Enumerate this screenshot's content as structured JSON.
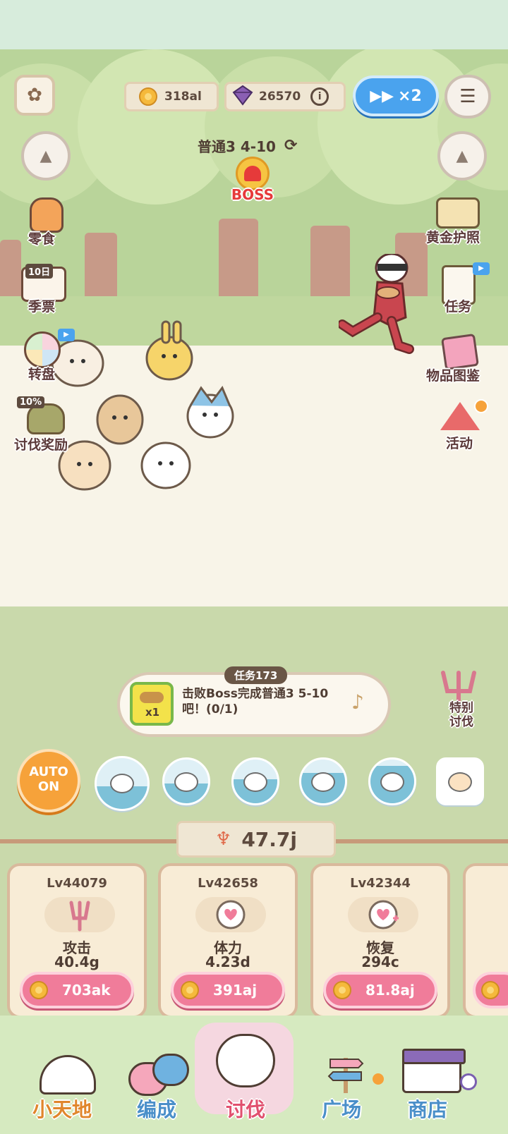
{
  "top_bar": {
    "coins": "318al",
    "gems": "26570",
    "speed_label": "×2"
  },
  "stage": {
    "label": "普通3 4-10",
    "boss_label": "BOSS"
  },
  "left_menu": [
    {
      "label": "零食"
    },
    {
      "label": "季票",
      "badge": "10日"
    },
    {
      "label": "转盘"
    },
    {
      "label": "讨伐奖励",
      "badge": "10%"
    }
  ],
  "right_menu": [
    {
      "label": "黄金护照"
    },
    {
      "label": "任务"
    },
    {
      "label": "物品图鉴"
    },
    {
      "label": "活动"
    }
  ],
  "mission": {
    "tag": "任务173",
    "reward_qty": "x1",
    "text": "击败Boss完成普通3 5-10吧！(0/1)"
  },
  "special": {
    "label": "特别讨伐"
  },
  "auto": {
    "line1": "AUTO",
    "line2": "ON"
  },
  "power": {
    "value": "47.7j"
  },
  "stats": [
    {
      "level": "Lv44079",
      "name": "攻击",
      "value": "40.4g",
      "cost": "703ak"
    },
    {
      "level": "Lv42658",
      "name": "体力",
      "value": "4.23d",
      "cost": "391aj"
    },
    {
      "level": "Lv42344",
      "name": "恢复",
      "value": "294c",
      "cost": "81.8aj"
    }
  ],
  "nav": [
    {
      "label": "小天地",
      "color": "#e0862c"
    },
    {
      "label": "编成",
      "color": "#4a8fc9"
    },
    {
      "label": "讨伐",
      "color": "#e1506f"
    },
    {
      "label": "广场",
      "color": "#4a8fc9"
    },
    {
      "label": "商店",
      "color": "#4a8fc9"
    }
  ],
  "colors": {
    "accent_pink": "#f07c9a",
    "speed_blue": "#4aa3ee",
    "auto_orange": "#f6a23a"
  }
}
